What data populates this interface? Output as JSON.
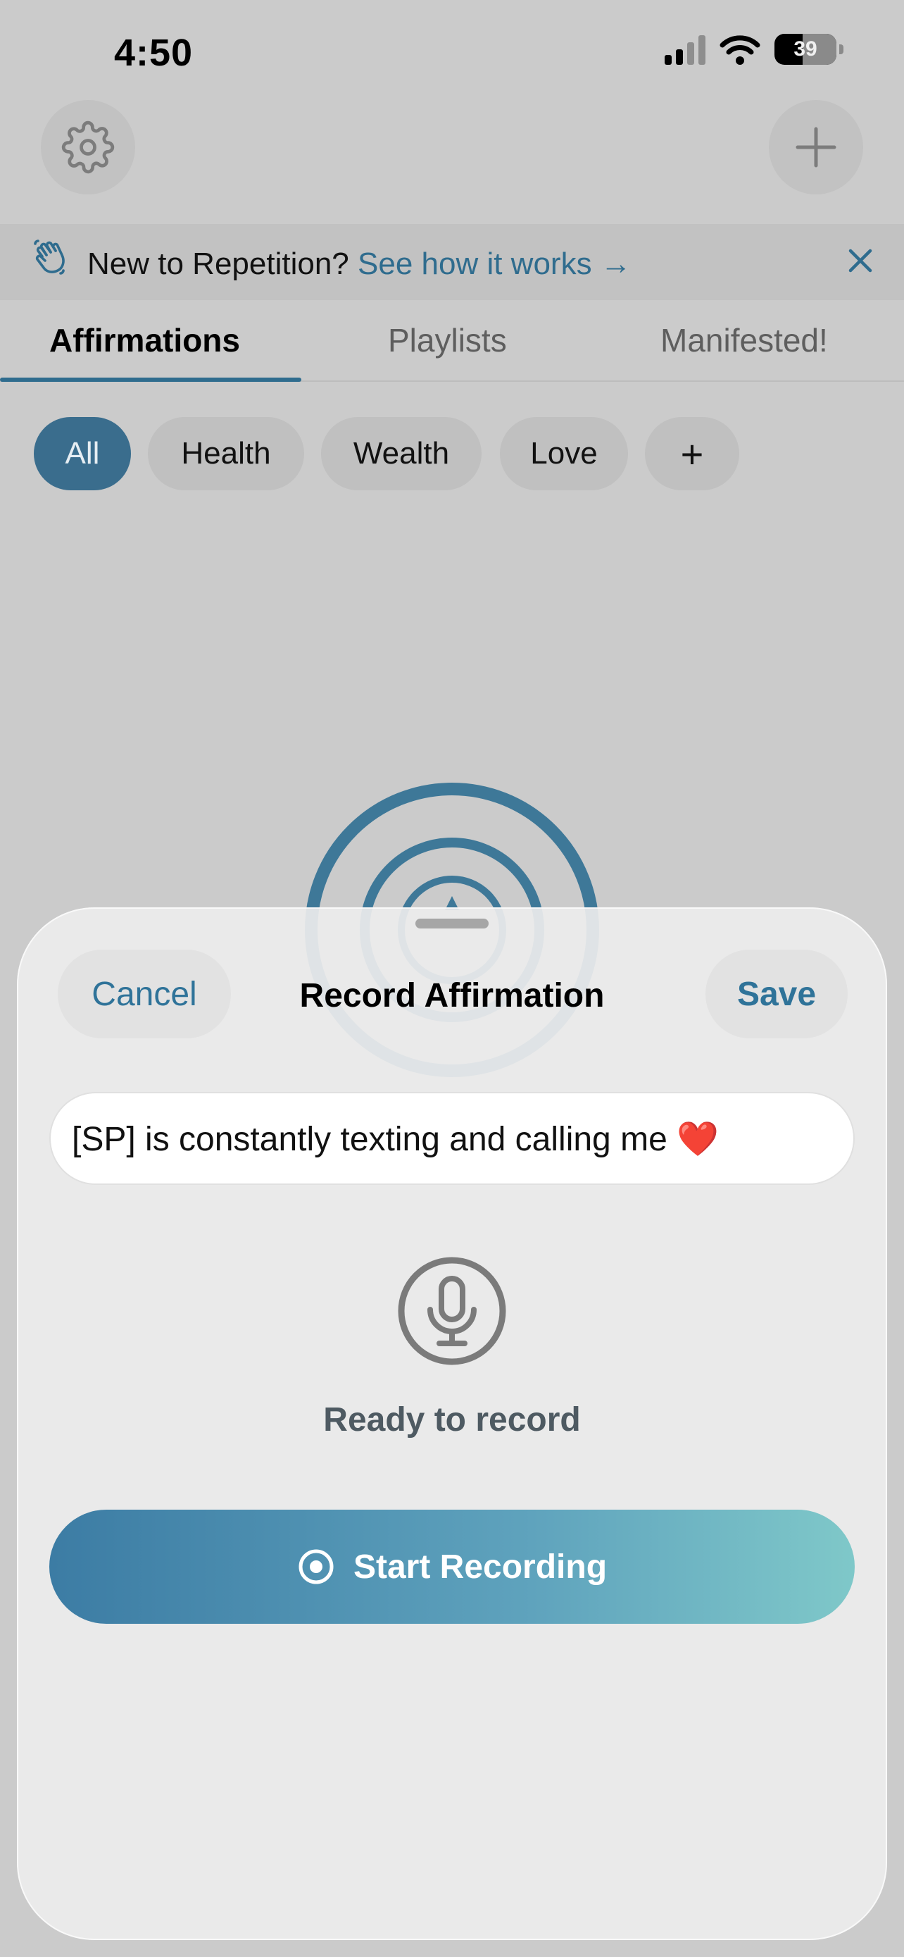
{
  "status_bar": {
    "time": "4:50",
    "battery_level": "39"
  },
  "banner": {
    "lead_text": "New to Repetition?",
    "link_text": "See how it works →"
  },
  "tabs": [
    {
      "label": "Affirmations",
      "active": true
    },
    {
      "label": "Playlists",
      "active": false
    },
    {
      "label": "Manifested!",
      "active": false
    }
  ],
  "categories": [
    {
      "label": "All",
      "active": true
    },
    {
      "label": "Health",
      "active": false
    },
    {
      "label": "Wealth",
      "active": false
    },
    {
      "label": "Love",
      "active": false
    },
    {
      "label": "+",
      "active": false
    }
  ],
  "sheet": {
    "title": "Record Affirmation",
    "cancel_label": "Cancel",
    "save_label": "Save",
    "affirmation_text": "[SP] is constantly texting and calling me ❤️",
    "status_text": "Ready to record",
    "start_label": "Start Recording"
  },
  "icons": {
    "settings": "gear-icon",
    "add": "plus-icon",
    "banner": "waving-hand-icon",
    "close": "close-icon",
    "mic": "microphone-icon",
    "record": "record-icon"
  },
  "colors": {
    "accent": "#2f6c8e",
    "chip_active": "#3a6d8d",
    "gradient_start": "#3c7ca4",
    "gradient_end": "#7fc8c9"
  }
}
